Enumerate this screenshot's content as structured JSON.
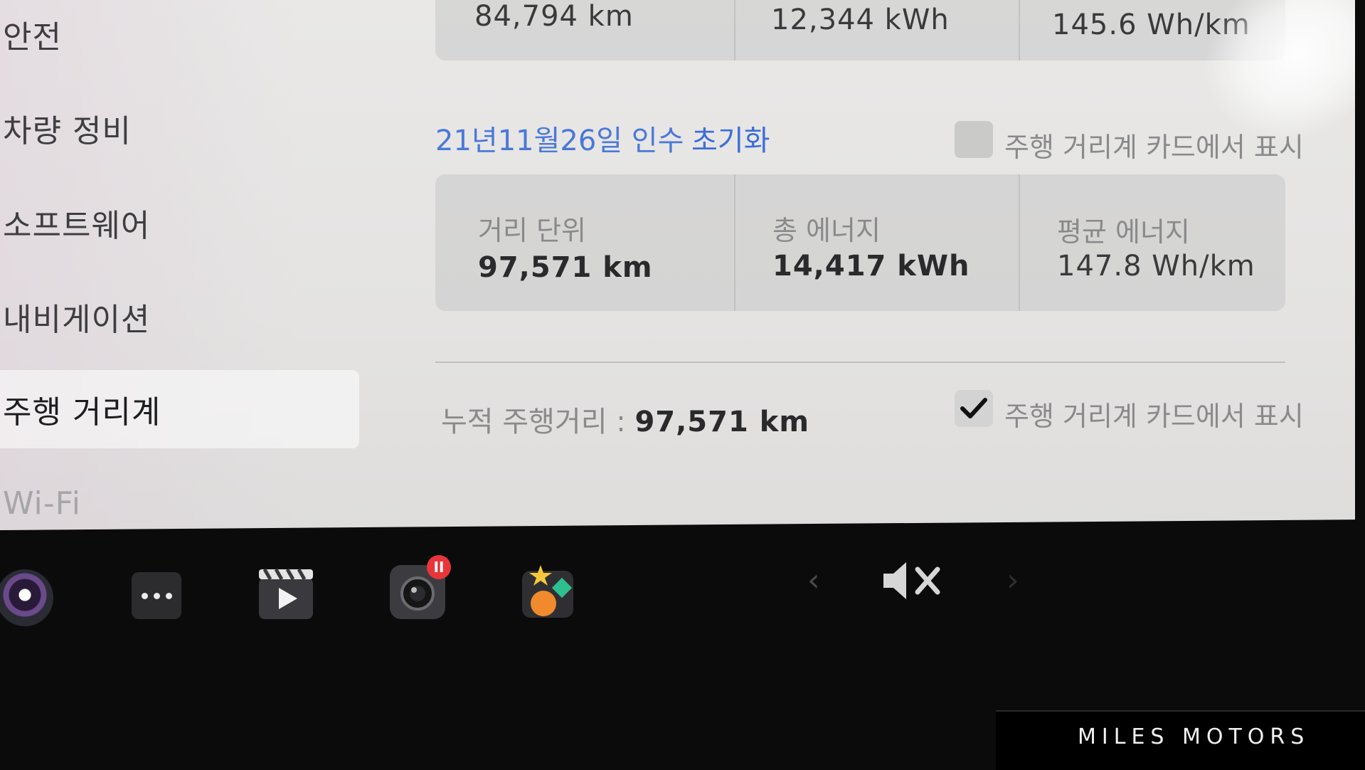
{
  "sidebar": {
    "items": [
      {
        "label": "안전"
      },
      {
        "label": "차량 정비"
      },
      {
        "label": "소프트웨어"
      },
      {
        "label": "내비게이션"
      },
      {
        "label": "주행 거리계"
      },
      {
        "label": "Wi-Fi"
      }
    ]
  },
  "trip_a": {
    "distance": "84,794 km",
    "energy": "12,344 kWh",
    "avg_energy": "145.6 Wh/km"
  },
  "trip_b": {
    "reset_info": "21년11월26일 인수",
    "reset_label": "초기화",
    "show_on_card_label": "주행 거리계 카드에서 표시",
    "show_on_card_checked": false,
    "distance_label": "거리 단위",
    "distance": "97,571 km",
    "energy_label": "총 에너지",
    "energy": "14,417 kWh",
    "avg_label": "평균 에너지",
    "avg_energy": "147.8 Wh/km"
  },
  "odometer": {
    "label": "누적 주행거리 :",
    "value": "97,571 km",
    "show_on_card_label": "주행 거리계 카드에서 표시",
    "show_on_card_checked": true
  },
  "taskbar": {
    "camera_badge": "II",
    "prev": "‹",
    "next": "›"
  },
  "watermark": "MILES MOTORS"
}
